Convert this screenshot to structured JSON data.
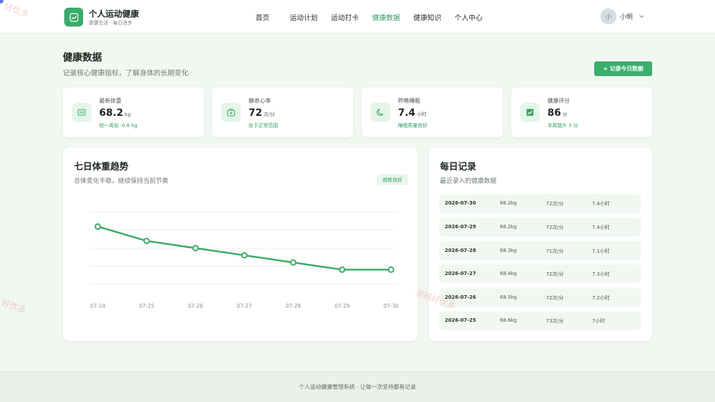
{
  "header": {
    "brand_title": "个人运动健康",
    "brand_sub": "健康生活 · 每日进步",
    "nav": [
      {
        "label": "首页",
        "active": false
      },
      {
        "label": "运动计划",
        "active": false
      },
      {
        "label": "运动打卡",
        "active": false
      },
      {
        "label": "健康数据",
        "active": true
      },
      {
        "label": "健康知识",
        "active": false
      },
      {
        "label": "个人中心",
        "active": false
      }
    ],
    "user_avatar_text": "小",
    "user_name": "小明"
  },
  "page": {
    "title": "健康数据",
    "subtitle": "记录核心健康指标，了解身体的长期变化",
    "record_button": "+ 记录今日数据"
  },
  "stats": [
    {
      "label": "最新体重",
      "value": "68.2",
      "unit": "kg",
      "note": "较一周前 -0.6 kg",
      "icon": "scale-icon"
    },
    {
      "label": "静息心率",
      "value": "72",
      "unit": "次/分",
      "note": "处于正常范围",
      "icon": "medical-kit-icon"
    },
    {
      "label": "昨晚睡眠",
      "value": "7.4",
      "unit": "小时",
      "note": "睡眠质量良好",
      "icon": "moon-icon"
    },
    {
      "label": "健康评分",
      "value": "86",
      "unit": "分",
      "note": "本周提升 3 分",
      "icon": "trend-chart-icon"
    }
  ],
  "weight_card": {
    "title": "七日体重趋势",
    "subtitle": "总体变化平稳，继续保持当前节奏",
    "badge": "趋势良好"
  },
  "chart_data": {
    "type": "line",
    "title": "七日体重趋势",
    "categories": [
      "07-24",
      "07-25",
      "07-26",
      "07-27",
      "07-28",
      "07-29",
      "07-30"
    ],
    "values": [
      68.8,
      68.6,
      68.5,
      68.4,
      68.3,
      68.2,
      68.2
    ],
    "ylim": [
      68.0,
      69.0
    ],
    "grid": true,
    "line_color": "#3aaa62"
  },
  "records_card": {
    "title": "每日记录",
    "subtitle": "最近录入的健康数据",
    "rows": [
      {
        "date": "2026-07-30",
        "weight": "68.2kg",
        "heart_rate": "72次/分",
        "sleep": "7.4小时"
      },
      {
        "date": "2026-07-29",
        "weight": "68.2kg",
        "heart_rate": "72次/分",
        "sleep": "7.4小时"
      },
      {
        "date": "2026-07-28",
        "weight": "68.3kg",
        "heart_rate": "71次/分",
        "sleep": "7.1小时"
      },
      {
        "date": "2026-07-27",
        "weight": "68.4kg",
        "heart_rate": "72次/分",
        "sleep": "7.3小时"
      },
      {
        "date": "2026-07-26",
        "weight": "68.5kg",
        "heart_rate": "72次/分",
        "sleep": "7.2小时"
      },
      {
        "date": "2026-07-25",
        "weight": "68.6kg",
        "heart_rate": "73次/分",
        "sleep": "7小时"
      }
    ]
  },
  "footer": {
    "text": "个人运动健康管理系统 · 让每一次坚持都有记录"
  },
  "watermarks": [
    "好优多",
    "好优多",
    "源码好优多"
  ],
  "colors": {
    "accent": "#3aae6a",
    "accent_text": "#2f9e5e",
    "page_bg": "#f1f7f1",
    "icon_bg": "#e6f5ea"
  }
}
